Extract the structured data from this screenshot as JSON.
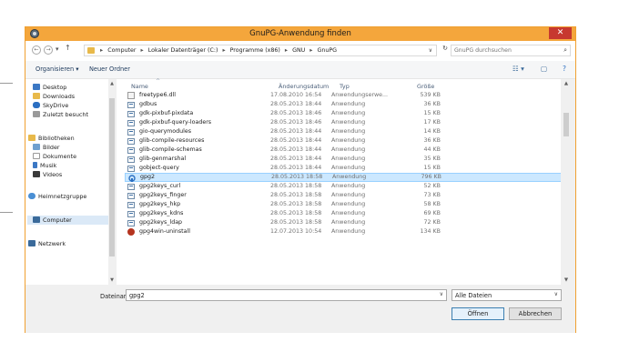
{
  "window": {
    "title": "GnuPG-Anwendung finden",
    "close_glyph": "✕"
  },
  "nav_buttons": {
    "back": "←",
    "forward": "→",
    "dropdown": "▾",
    "up": "↑"
  },
  "address": {
    "crumbs": [
      "Computer",
      "Lokaler Datenträger (C:)",
      "Programme (x86)",
      "GNU",
      "GnuPG"
    ],
    "separator": "▸",
    "dropdown": "∨",
    "refresh": "↻"
  },
  "search": {
    "placeholder": "GnuPG durchsuchen",
    "icon": "⌕"
  },
  "toolbar": {
    "organize": "Organisieren ▾",
    "new_folder": "Neuer Ordner",
    "view_icon": "☷ ▾",
    "pane_icon": "▢",
    "help_icon": "?"
  },
  "nav_items": [
    {
      "label": "Desktop",
      "icon": "desktop-icon",
      "color": "#3b78c4"
    },
    {
      "label": "Downloads",
      "icon": "downloads-icon",
      "color": "#e8b94a"
    },
    {
      "label": "SkyDrive",
      "icon": "skydrive-icon",
      "color": "#2b6fc2"
    },
    {
      "label": "Zuletzt besucht",
      "icon": "recent-icon",
      "color": "#9a9a9a"
    },
    {
      "label": "Bibliotheken",
      "icon": "libraries-icon",
      "color": "#e8b94a"
    },
    {
      "label": "Bilder",
      "icon": "pictures-icon",
      "color": "#6fa0cf"
    },
    {
      "label": "Dokumente",
      "icon": "documents-icon",
      "color": "#d8d8d8"
    },
    {
      "label": "Musik",
      "icon": "music-icon",
      "color": "#3b78c4"
    },
    {
      "label": "Videos",
      "icon": "videos-icon",
      "color": "#3a3a3a"
    },
    {
      "label": "Heimnetzgruppe",
      "icon": "homegroup-icon",
      "color": "#4a8fd4"
    },
    {
      "label": "Computer",
      "icon": "computer-icon",
      "color": "#3a6a9a"
    },
    {
      "label": "Netzwerk",
      "icon": "network-icon",
      "color": "#3a6a9a"
    }
  ],
  "columns": {
    "name": "Name",
    "date": "Änderungsdatum",
    "type": "Typ",
    "size": "Größe",
    "sort_indicator": "^"
  },
  "files": [
    {
      "name": "freetype6.dll",
      "date": "17.08.2010 16:54",
      "type": "Anwendungserwe...",
      "size": "539 KB",
      "icon": "dll-icon"
    },
    {
      "name": "gdbus",
      "date": "28.05.2013 18:44",
      "type": "Anwendung",
      "size": "36 KB",
      "icon": "exe-icon"
    },
    {
      "name": "gdk-pixbuf-pixdata",
      "date": "28.05.2013 18:46",
      "type": "Anwendung",
      "size": "15 KB",
      "icon": "exe-icon"
    },
    {
      "name": "gdk-pixbuf-query-loaders",
      "date": "28.05.2013 18:46",
      "type": "Anwendung",
      "size": "17 KB",
      "icon": "exe-icon"
    },
    {
      "name": "gio-querymodules",
      "date": "28.05.2013 18:44",
      "type": "Anwendung",
      "size": "14 KB",
      "icon": "exe-icon"
    },
    {
      "name": "glib-compile-resources",
      "date": "28.05.2013 18:44",
      "type": "Anwendung",
      "size": "36 KB",
      "icon": "exe-icon"
    },
    {
      "name": "glib-compile-schemas",
      "date": "28.05.2013 18:44",
      "type": "Anwendung",
      "size": "44 KB",
      "icon": "exe-icon"
    },
    {
      "name": "glib-genmarshal",
      "date": "28.05.2013 18:44",
      "type": "Anwendung",
      "size": "35 KB",
      "icon": "exe-icon"
    },
    {
      "name": "gobject-query",
      "date": "28.05.2013 18:44",
      "type": "Anwendung",
      "size": "15 KB",
      "icon": "exe-icon"
    },
    {
      "name": "gpg2",
      "date": "28.05.2013 18:58",
      "type": "Anwendung",
      "size": "796 KB",
      "icon": "gpg-icon",
      "selected": true
    },
    {
      "name": "gpg2keys_curl",
      "date": "28.05.2013 18:58",
      "type": "Anwendung",
      "size": "52 KB",
      "icon": "exe-icon"
    },
    {
      "name": "gpg2keys_finger",
      "date": "28.05.2013 18:58",
      "type": "Anwendung",
      "size": "73 KB",
      "icon": "exe-icon"
    },
    {
      "name": "gpg2keys_hkp",
      "date": "28.05.2013 18:58",
      "type": "Anwendung",
      "size": "58 KB",
      "icon": "exe-icon"
    },
    {
      "name": "gpg2keys_kdns",
      "date": "28.05.2013 18:58",
      "type": "Anwendung",
      "size": "69 KB",
      "icon": "exe-icon"
    },
    {
      "name": "gpg2keys_ldap",
      "date": "28.05.2013 18:58",
      "type": "Anwendung",
      "size": "72 KB",
      "icon": "exe-icon"
    },
    {
      "name": "gpg4win-uninstall",
      "date": "12.07.2013 10:54",
      "type": "Anwendung",
      "size": "134 KB",
      "icon": "uninstall-icon"
    }
  ],
  "bottom": {
    "filename_label": "Dateiname:",
    "filename_value": "gpg2",
    "filter_value": "Alle Dateien",
    "dropdown": "∨",
    "open_label": "Öffnen",
    "cancel_label": "Abbrechen"
  },
  "colors": {
    "titlebar": "#f4a63c",
    "close": "#c7382f",
    "selection": "#cce8ff"
  }
}
